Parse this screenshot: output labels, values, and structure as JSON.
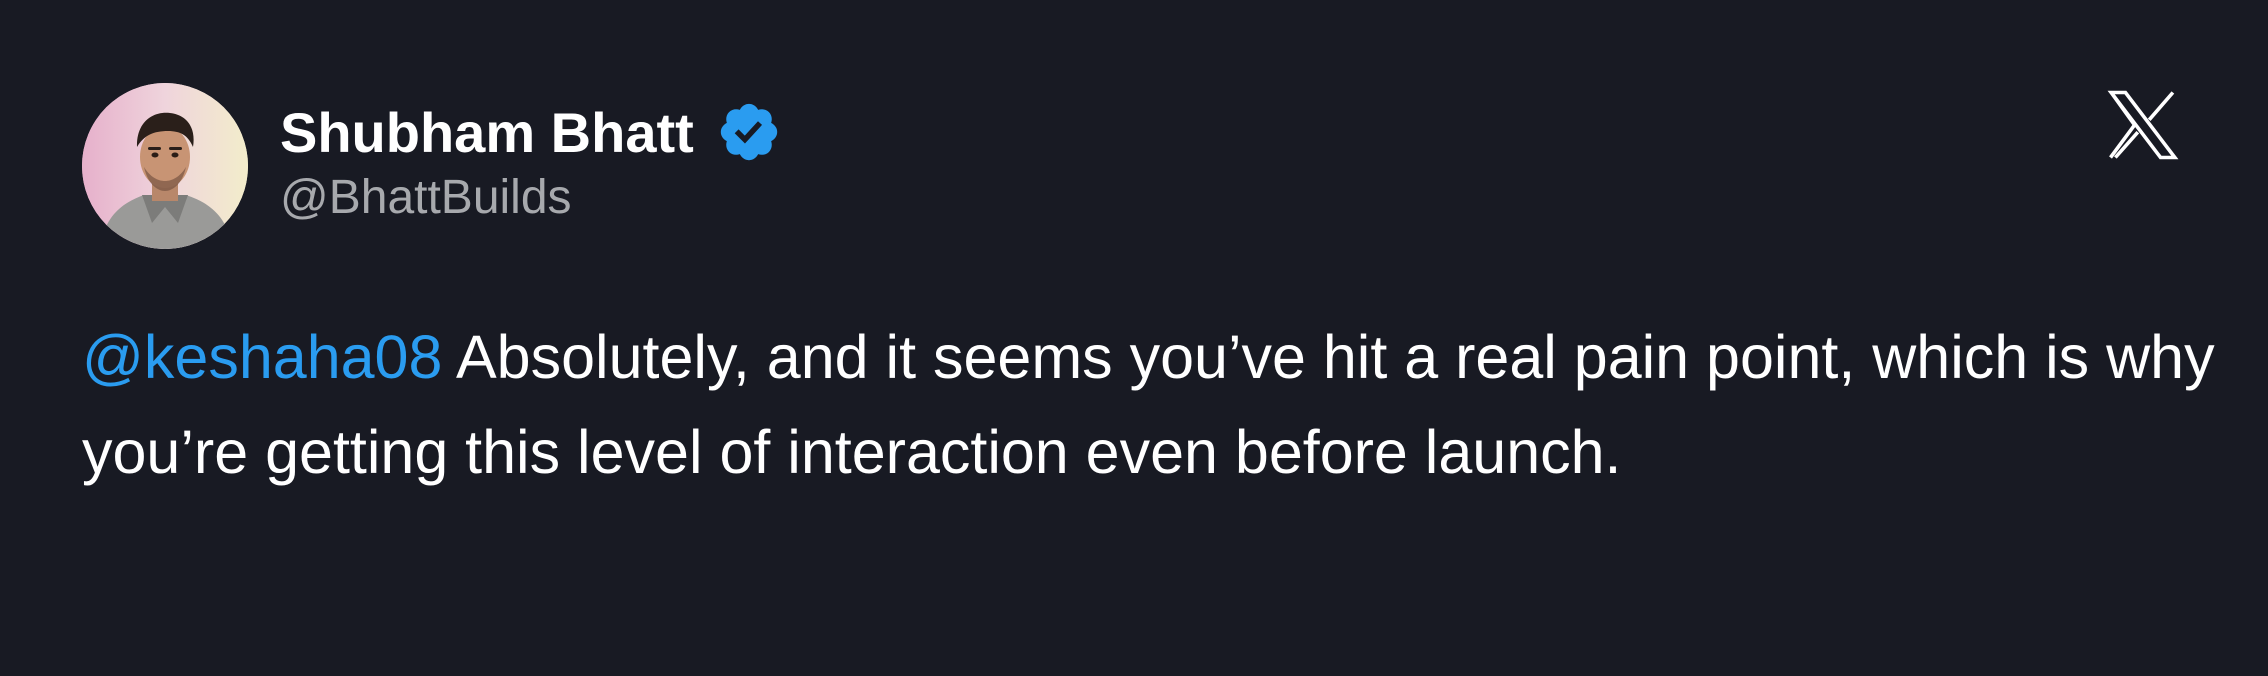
{
  "tweet": {
    "author": {
      "display_name": "Shubham Bhatt",
      "handle": "@BhattBuilds",
      "verified": true,
      "avatar_icon": "profile-photo"
    },
    "body": {
      "mention": "@keshaha08",
      "text": "Absolutely, and it seems you’ve hit a real pain point, which is why you’re getting this level of interaction even before launch."
    },
    "platform_icon": "x-logo-icon"
  },
  "colors": {
    "background": "#181a23",
    "text": "#ffffff",
    "handle_text": "#a7a9ad",
    "mention": "#2a9cf0",
    "verified_badge": "#2a9cf0"
  }
}
